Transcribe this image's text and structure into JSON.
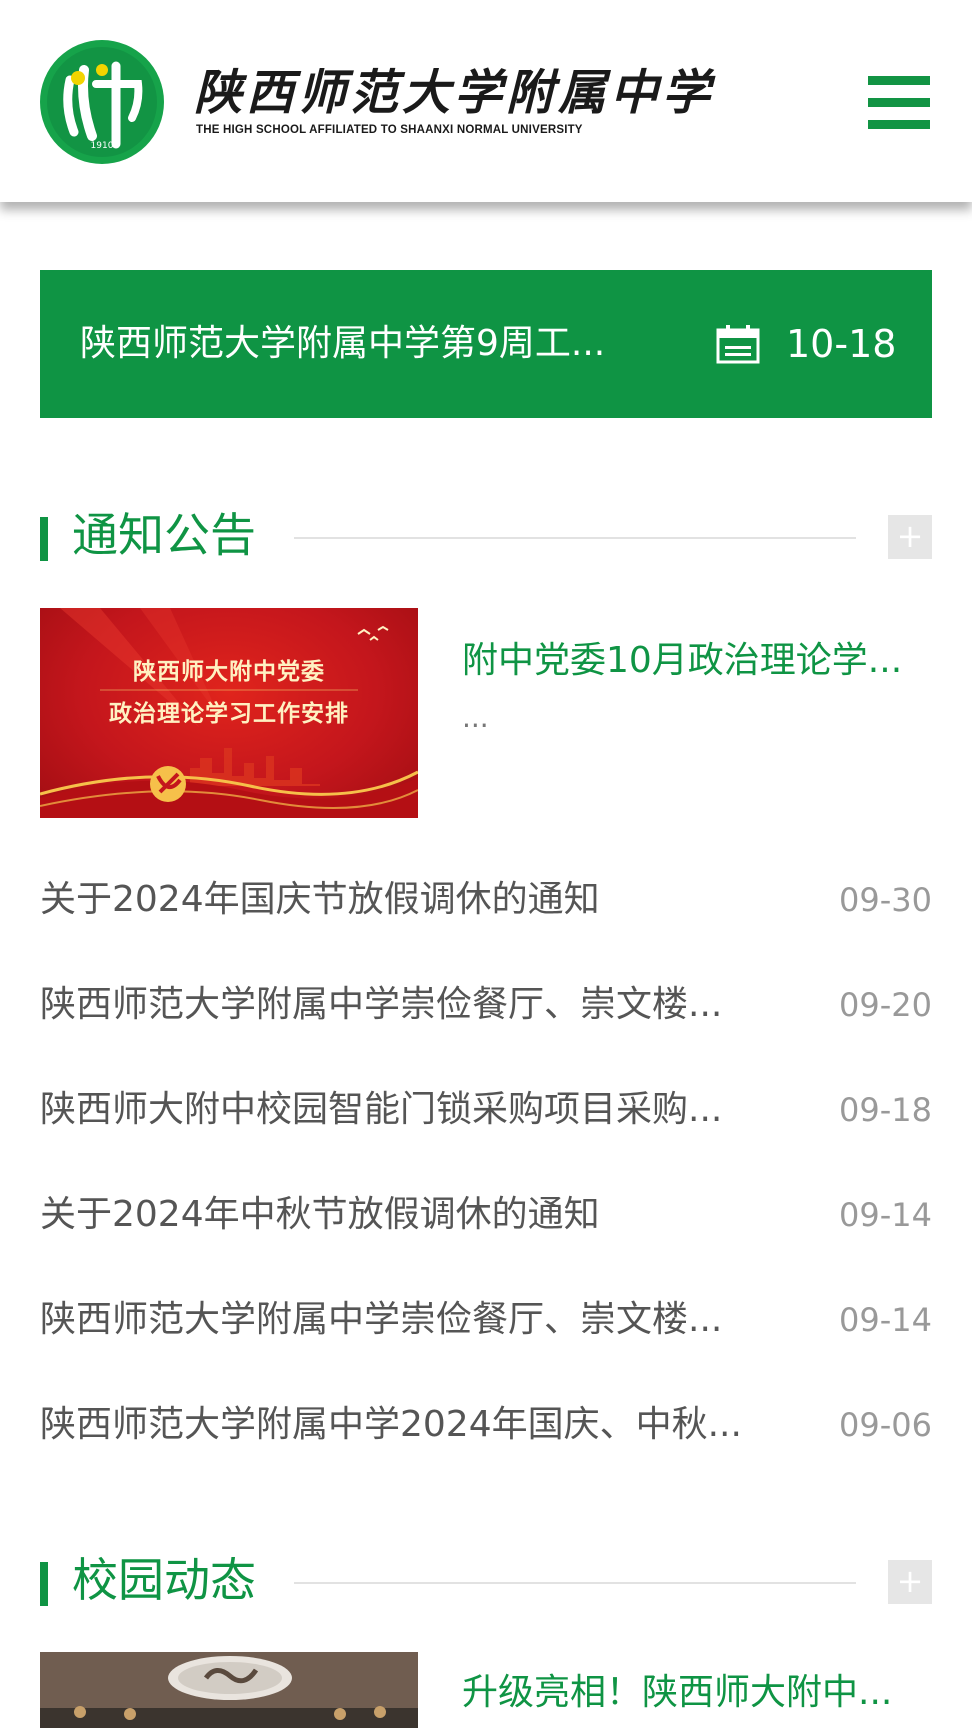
{
  "header": {
    "logo_title_cn": "陕西师范大学附属中学",
    "logo_title_en": "THE HIGH SCHOOL AFFILIATED TO SHAANXI NORMAL UNIVERSITY",
    "logo_year": "1910",
    "menu_icon": "hamburger-menu-icon",
    "brand_color": "#0f9444"
  },
  "banner": {
    "title": "陕西师范大学附属中学第9周工...",
    "date": "10-18",
    "icon": "calendar-icon"
  },
  "notices": {
    "section_title": "通知公告",
    "more_label": "+",
    "featured": {
      "image_line1": "陕西师大附中党委",
      "image_line2": "政治理论学习工作安排",
      "title": "附中党委10月政治理论学...",
      "summary": "..."
    },
    "items": [
      {
        "title": "关于2024年国庆节放假调休的通知",
        "date": "09-30"
      },
      {
        "title": "陕西师范大学附属中学崇俭餐厅、崇文楼...",
        "date": "09-20"
      },
      {
        "title": "陕西师大附中校园智能门锁采购项目采购...",
        "date": "09-18"
      },
      {
        "title": "关于2024年中秋节放假调休的通知",
        "date": "09-14"
      },
      {
        "title": "陕西师范大学附属中学崇俭餐厅、崇文楼...",
        "date": "09-14"
      },
      {
        "title": "陕西师范大学附属中学2024年国庆、中秋...",
        "date": "09-06"
      }
    ]
  },
  "campus_news": {
    "section_title": "校园动态",
    "more_label": "+",
    "featured": {
      "title": "升级亮相！陕西师大附中..."
    }
  }
}
